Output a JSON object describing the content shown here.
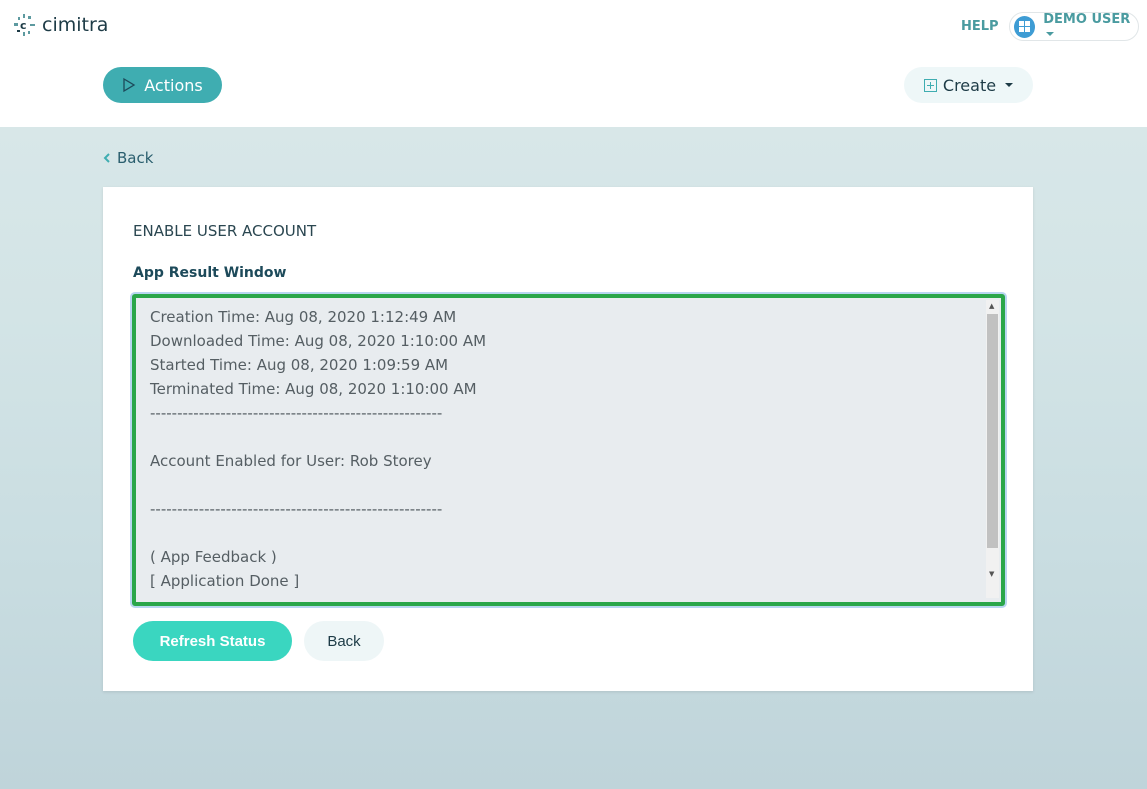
{
  "header": {
    "logo_text": "cimitra",
    "help": "HELP",
    "user": "DEMO USER"
  },
  "toolbar": {
    "actions": "Actions",
    "create": "Create"
  },
  "nav": {
    "back": "Back"
  },
  "card": {
    "title": "ENABLE USER ACCOUNT",
    "result_label": "App Result Window",
    "result_text": "Creation Time: Aug 08, 2020 1:12:49 AM\nDownloaded Time: Aug 08, 2020 1:10:00 AM\nStarted Time: Aug 08, 2020 1:09:59 AM\nTerminated Time: Aug 08, 2020 1:10:00 AM\n------------------------------------------------------\n\nAccount Enabled for User: Rob Storey\n\n------------------------------------------------------\n\n( App Feedback )\n[ Application Done ]",
    "refresh": "Refresh Status",
    "back": "Back"
  },
  "colors": {
    "accent": "#3fadb1",
    "refresh": "#3ad6c0",
    "focus_border": "#2aa64a"
  }
}
